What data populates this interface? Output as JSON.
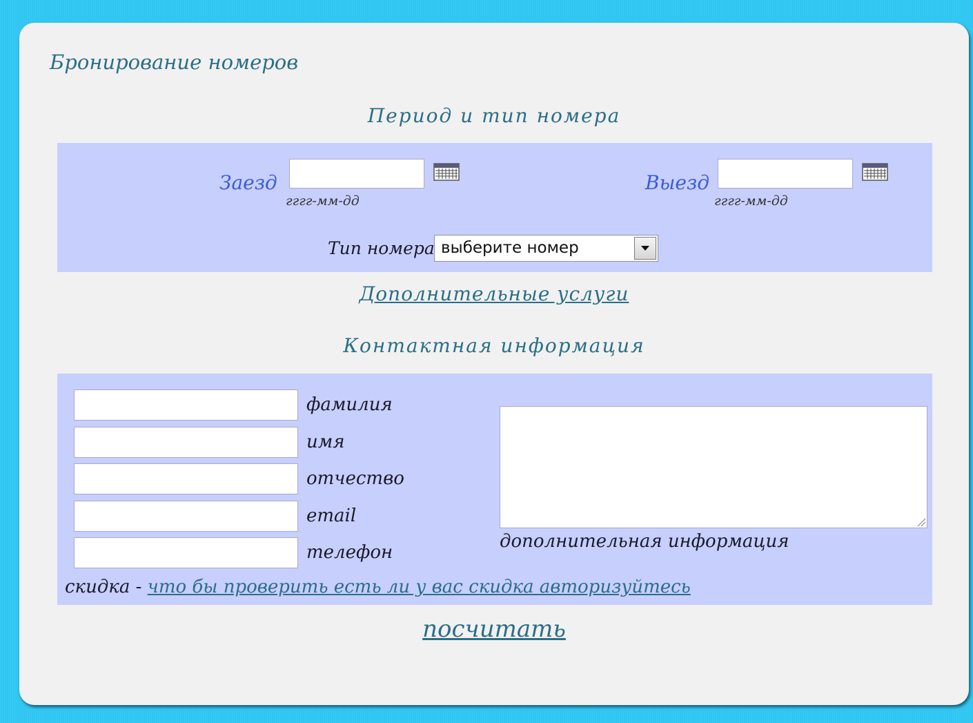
{
  "page": {
    "title": "Бронирование номеров"
  },
  "period_section": {
    "heading": "Период и тип номера",
    "checkin_label": "Заезд",
    "checkin_value": "",
    "checkin_hint": "гггг-мм-дд",
    "checkout_label": "Выезд",
    "checkout_value": "",
    "checkout_hint": "гггг-мм-дд",
    "room_type_label": "Тип номера",
    "room_type_selected": "выберите номер"
  },
  "extra_services_link": "Дополнительные услуги",
  "contact_section": {
    "heading": "Контактная информация",
    "fields": [
      {
        "label": "фамилия",
        "value": ""
      },
      {
        "label": "имя",
        "value": ""
      },
      {
        "label": "отчество",
        "value": ""
      },
      {
        "label": "email",
        "value": ""
      },
      {
        "label": "телефон",
        "value": ""
      }
    ],
    "additional_info_label": "дополнительная информация",
    "additional_info_value": "",
    "discount_label": "скидка -",
    "discount_link": "что бы проверить есть ли у вас скидка авторизуйтесь"
  },
  "calculate_link": "посчитать",
  "colors": {
    "background": "#2ec6f2",
    "page": "#f1f1f1",
    "panel": "#c7cffd",
    "heading": "#2b6e86",
    "field_label": "#3a5bd6"
  },
  "icons": {
    "calendar": "calendar-icon",
    "dropdown": "chevron-down-icon",
    "resize": "resize-grip-icon"
  }
}
